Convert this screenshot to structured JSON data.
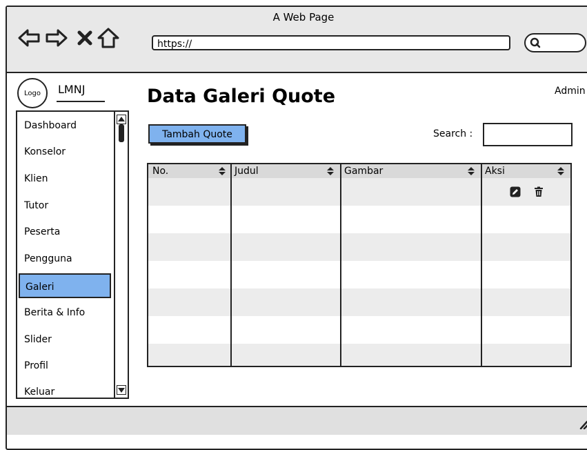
{
  "window": {
    "title": "A Web Page"
  },
  "browser": {
    "url": "https://"
  },
  "brand": {
    "logo": "Logo",
    "name": "LMNJ"
  },
  "sidebar": {
    "items": [
      {
        "label": "Dashboard"
      },
      {
        "label": "Konselor"
      },
      {
        "label": "Klien"
      },
      {
        "label": "Tutor"
      },
      {
        "label": "Peserta"
      },
      {
        "label": "Pengguna"
      },
      {
        "label": "Galeri",
        "active": true
      },
      {
        "label": "Berita & Info"
      },
      {
        "label": "Slider"
      },
      {
        "label": "Profil"
      },
      {
        "label": "Keluar"
      }
    ]
  },
  "main": {
    "title": "Data Galeri Quote",
    "user": "Admin",
    "add_button": "Tambah Quote",
    "search_label": "Search :",
    "search_value": ""
  },
  "table": {
    "columns": [
      "No.",
      "Judul",
      "Gambar",
      "Aksi"
    ],
    "action_icons": [
      "edit-icon",
      "trash-icon"
    ]
  },
  "colors": {
    "accent": "#7fb2ee",
    "stroke": "#222222",
    "stripe": "#ececec"
  }
}
